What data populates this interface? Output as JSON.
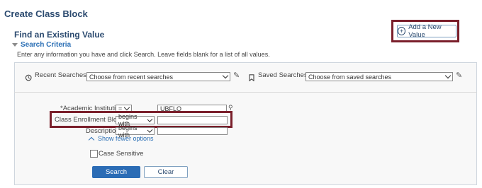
{
  "page": {
    "title": "Create Class Block"
  },
  "find": {
    "title": "Find an Existing Value",
    "criteria_label": "Search Criteria",
    "instructions": "Enter any information you have and click Search. Leave fields blank for a list of all values."
  },
  "add_button": {
    "label": "Add a New Value",
    "icon": "plus-circle-icon"
  },
  "recent": {
    "label": "Recent Searches",
    "placeholder": "Choose from recent searches"
  },
  "saved": {
    "label": "Saved Searches",
    "placeholder": "Choose from saved searches"
  },
  "fields": {
    "institution": {
      "label": "*Academic Institution",
      "operator": "=",
      "value": "UBFLO"
    },
    "enrollment_block": {
      "label": "Class Enrollment Block",
      "operator": "begins with",
      "value": ""
    },
    "description": {
      "label": "Description",
      "operator": "begins with",
      "value": ""
    }
  },
  "show_fewer": "Show fewer options",
  "case_sensitive": {
    "label": "Case Sensitive",
    "checked": false
  },
  "buttons": {
    "search": "Search",
    "clear": "Clear"
  },
  "colors": {
    "highlight": "#7a1f2b",
    "primary": "#2b6cb5",
    "heading": "#2b4a6f"
  }
}
